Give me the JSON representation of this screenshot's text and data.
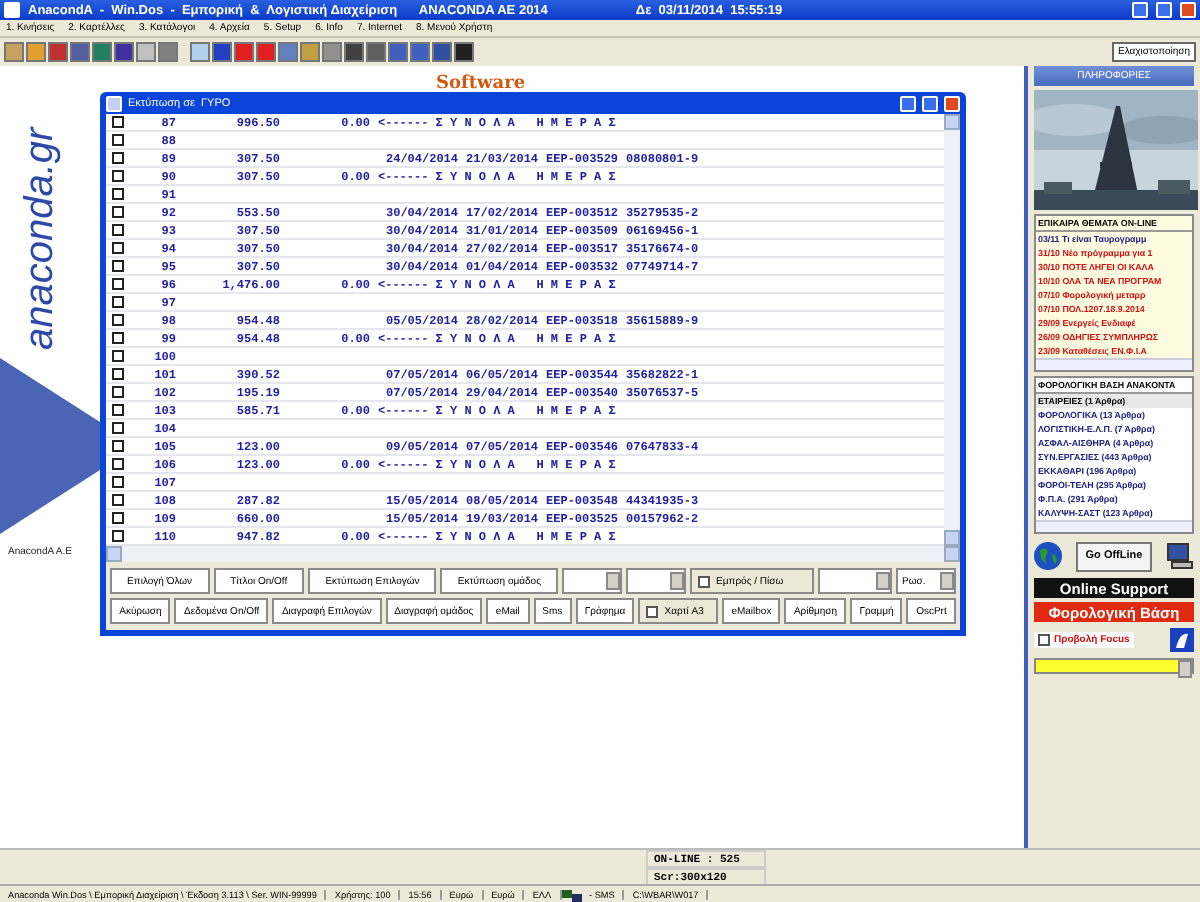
{
  "window": {
    "title": "AnacondA  -  Win.Dos  -  Εμπορική  &  Λογιστική Διαχείριση      ANACONDA AE 2014",
    "clock": "Δε  03/11/2014  15:55:19"
  },
  "menu": [
    "1. Κινήσεις",
    "2. Καρτέλλες",
    "3. Κατάλογοι",
    "4. Αρχεία",
    "5. Setup",
    "6. Info",
    "7. Internet",
    "8. Μενού Χρήστη"
  ],
  "toolbar": {
    "minimize_button": "Ελαχιστοποίηση"
  },
  "desktop": {
    "logo": "Software",
    "site": "anaconda.gr",
    "company": "AnacondA A.E"
  },
  "report_window": {
    "title": "Εκτύπωση σε  ΓΥΡΟ",
    "rows": [
      {
        "kind": "total",
        "no": "87",
        "amount": "996.50",
        "vat": "0.00",
        "label": "<------ Σ Υ Ν Ο Λ Α   Η Μ Ε Ρ Α Σ",
        "checked": false
      },
      {
        "kind": "blank",
        "no": "88",
        "checked": false
      },
      {
        "kind": "detail",
        "no": "89",
        "amount": "307.50",
        "date_1": "24/04/2014",
        "date_2": "21/03/2014",
        "doc": "EEP-003529",
        "code": "08080801-9",
        "checked": false
      },
      {
        "kind": "total",
        "no": "90",
        "amount": "307.50",
        "vat": "0.00",
        "label": "<------ Σ Υ Ν Ο Λ Α   Η Μ Ε Ρ Α Σ",
        "checked": false
      },
      {
        "kind": "blank",
        "no": "91",
        "checked": false
      },
      {
        "kind": "detail",
        "no": "92",
        "amount": "553.50",
        "date_1": "30/04/2014",
        "date_2": "17/02/2014",
        "doc": "EEP-003512",
        "code": "35279535-2",
        "checked": false
      },
      {
        "kind": "detail",
        "no": "93",
        "amount": "307.50",
        "date_1": "30/04/2014",
        "date_2": "31/01/2014",
        "doc": "EEP-003509",
        "code": "06169456-1",
        "checked": false
      },
      {
        "kind": "detail",
        "no": "94",
        "amount": "307.50",
        "date_1": "30/04/2014",
        "date_2": "27/02/2014",
        "doc": "EEP-003517",
        "code": "35176674-0",
        "checked": false
      },
      {
        "kind": "detail",
        "no": "95",
        "amount": "307.50",
        "date_1": "30/04/2014",
        "date_2": "01/04/2014",
        "doc": "EEP-003532",
        "code": "07749714-7",
        "checked": false
      },
      {
        "kind": "total",
        "no": "96",
        "amount": "1,476.00",
        "vat": "0.00",
        "label": "<------ Σ Υ Ν Ο Λ Α   Η Μ Ε Ρ Α Σ",
        "checked": false
      },
      {
        "kind": "blank",
        "no": "97",
        "checked": false
      },
      {
        "kind": "detail",
        "no": "98",
        "amount": "954.48",
        "date_1": "05/05/2014",
        "date_2": "28/02/2014",
        "doc": "EEP-003518",
        "code": "35615889-9",
        "checked": false
      },
      {
        "kind": "total",
        "no": "99",
        "amount": "954.48",
        "vat": "0.00",
        "label": "<------ Σ Υ Ν Ο Λ Α   Η Μ Ε Ρ Α Σ",
        "checked": false
      },
      {
        "kind": "blank",
        "no": "100",
        "checked": false
      },
      {
        "kind": "detail",
        "no": "101",
        "amount": "390.52",
        "date_1": "07/05/2014",
        "date_2": "06/05/2014",
        "doc": "EEP-003544",
        "code": "35682822-1",
        "checked": false
      },
      {
        "kind": "detail",
        "no": "102",
        "amount": "195.19",
        "date_1": "07/05/2014",
        "date_2": "29/04/2014",
        "doc": "EEP-003540",
        "code": "35076537-5",
        "checked": false
      },
      {
        "kind": "total",
        "no": "103",
        "amount": "585.71",
        "vat": "0.00",
        "label": "<------ Σ Υ Ν Ο Λ Α   Η Μ Ε Ρ Α Σ",
        "checked": false
      },
      {
        "kind": "blank",
        "no": "104",
        "checked": false
      },
      {
        "kind": "detail",
        "no": "105",
        "amount": "123.00",
        "date_1": "09/05/2014",
        "date_2": "07/05/2014",
        "doc": "EEP-003546",
        "code": "07647833-4",
        "checked": false
      },
      {
        "kind": "total",
        "no": "106",
        "amount": "123.00",
        "vat": "0.00",
        "label": "<------ Σ Υ Ν Ο Λ Α   Η Μ Ε Ρ Α Σ",
        "checked": false
      },
      {
        "kind": "blank",
        "no": "107",
        "checked": false
      },
      {
        "kind": "detail",
        "no": "108",
        "amount": "287.82",
        "date_1": "15/05/2014",
        "date_2": "08/05/2014",
        "doc": "EEP-003548",
        "code": "44341935-3",
        "checked": false
      },
      {
        "kind": "detail",
        "no": "109",
        "amount": "660.00",
        "date_1": "15/05/2014",
        "date_2": "19/03/2014",
        "doc": "EEP-003525",
        "code": "00157962-2",
        "checked": false
      },
      {
        "kind": "total",
        "no": "110",
        "amount": "947.82",
        "vat": "0.00",
        "label": "<------ Σ Υ Ν Ο Λ Α   Η Μ Ε Ρ Α Σ",
        "checked": false
      }
    ],
    "controls_row_1": [
      {
        "kind": "button",
        "label": "Επιλογή Όλων"
      },
      {
        "kind": "button",
        "label": "Τίτλοι On/Off"
      },
      {
        "kind": "button",
        "label": "Εκτύπωση Επιλογών"
      },
      {
        "kind": "button",
        "label": "Εκτύπωση ομάδος"
      },
      {
        "kind": "dropdown"
      },
      {
        "kind": "dropdown"
      },
      {
        "kind": "checkbox",
        "label": "Εμπρός / Πίσω",
        "checked": false
      },
      {
        "kind": "wide_dropdown"
      },
      {
        "kind": "dropdown",
        "value": "Ρωσ."
      }
    ],
    "controls_row_2": [
      {
        "kind": "button",
        "label": "Ακύρωση"
      },
      {
        "kind": "button",
        "label": "Δεδομένα On/Off"
      },
      {
        "kind": "button",
        "label": "Διαγραφή Επιλογών"
      },
      {
        "kind": "button",
        "label": "Διαγραφή ομάδος"
      },
      {
        "kind": "button",
        "label": "eMail"
      },
      {
        "kind": "button",
        "label": "Sms"
      },
      {
        "kind": "button",
        "label": "Γράφημα"
      },
      {
        "kind": "checkbox",
        "label": "Χαρτί A3",
        "checked": false
      },
      {
        "kind": "button",
        "label": "eMailbox"
      },
      {
        "kind": "button",
        "label": "Αρίθμηση"
      },
      {
        "kind": "button",
        "label": "Γραμμή"
      },
      {
        "kind": "button",
        "label": "OscPrt"
      }
    ]
  },
  "info_panel": {
    "title": "ΠΛΗΡΟΦΟΡΙΕΣ",
    "news": {
      "title": "ΕΠΙΚΑΙΡΑ ΘΕΜΑΤΑ ON-LINE",
      "items": [
        {
          "text": "03/11 Τι είναι Ταυρογραμμ",
          "color": "#202080"
        },
        {
          "text": "31/10 Νέο πρόγραμμα για 1",
          "color": "#d01010"
        },
        {
          "text": "30/10 ΠΟΤΕ ΛΗΓΕΙ ΟΙ ΚΑΛΑ",
          "color": "#d01010"
        },
        {
          "text": "10/10 ΟΛΑ ΤΑ ΝΕΑ ΠΡΟΓΡΑΜ",
          "color": "#d01010"
        },
        {
          "text": "07/10 Φορολογική μεταρρ",
          "color": "#d01010"
        },
        {
          "text": "07/10 ΠΟΛ.1207.18.9.2014",
          "color": "#d01010"
        },
        {
          "text": "29/09 Ενεργείς Ενδιαφέ",
          "color": "#d01010"
        },
        {
          "text": "26/09 ΟΔΗΓΙΕΣ ΣΥΜΠΛΗΡΩΣ",
          "color": "#d01010"
        },
        {
          "text": "23/09 Καταθέσεις ΕΝ.Φ.Ι.Α",
          "color": "#d01010"
        }
      ]
    },
    "tax_base": {
      "title": "ΦΟΡΟΛΟΓΙΚΗ ΒΑΣΗ ΑΝΑΚΟΝΤΑ",
      "items": [
        {
          "text": "ΕΤΑΙΡΕΙΕΣ (1 Άρθρα)",
          "selected": true
        },
        {
          "text": "ΦΟΡΟΛΟΓΙΚΑ (13 Άρθρα)",
          "selected": false
        },
        {
          "text": "ΛΟΓΙΣΤΙΚΗ-Ε.Λ.Π. (7 Άρθρα)",
          "selected": false
        },
        {
          "text": "ΑΣΦΑΛ-ΑΙΣΘΗΡΑ (4 Άρθρα)",
          "selected": false
        },
        {
          "text": "ΣΥΝ.ΕΡΓΑΣΙΕΣ (443 Άρθρα)",
          "selected": false
        },
        {
          "text": "ΕΚΚΑΘΑΡΙ (196 Άρθρα)",
          "selected": false
        },
        {
          "text": "ΦΟΡΟΙ-ΤΕΛΗ (295 Άρθρα)",
          "selected": false
        },
        {
          "text": "Φ.Π.Α. (291 Άρθρα)",
          "selected": false
        },
        {
          "text": "ΚΑΛΥΨΗ-ΣΑΣΤ (123 Άρθρα)",
          "selected": false
        }
      ]
    },
    "offline_button": "Go OffLine",
    "support_banner": "Online Support",
    "tax_banner": "Φορολογική Βάση",
    "focus_checkbox": {
      "label": "Προβολή Focus",
      "checked": false
    }
  },
  "status": {
    "online": "ON-LINE : 525",
    "screen": "Scr:300x120",
    "segments": [
      "Anaconda Win.Dos \\ Εμπορική Διαχείριση \\ Έκδοση 3.113 \\ Ser. WIN-99999",
      "Χρήστης: 100",
      "15:56",
      "Ευρώ",
      "Ευρώ",
      "ΕΛΛ"
    ],
    "sms": "- SMS",
    "path": "C:\\WBAR\\W017"
  }
}
